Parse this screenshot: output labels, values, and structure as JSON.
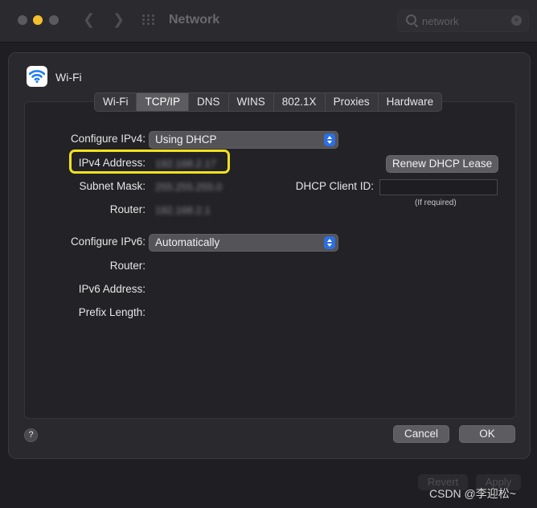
{
  "titlebar": {
    "title": "Network",
    "search_value": "network",
    "icons": [
      "close-dot",
      "minimize-dot",
      "maximize-dot",
      "back-arrow",
      "forward-arrow",
      "grid-icon",
      "search-icon",
      "clear-icon"
    ]
  },
  "sheet": {
    "interface_name": "Wi-Fi",
    "tabs": [
      {
        "label": "Wi-Fi",
        "active": false
      },
      {
        "label": "TCP/IP",
        "active": true
      },
      {
        "label": "DNS",
        "active": false
      },
      {
        "label": "WINS",
        "active": false
      },
      {
        "label": "802.1X",
        "active": false
      },
      {
        "label": "Proxies",
        "active": false
      },
      {
        "label": "Hardware",
        "active": false
      }
    ],
    "ipv4": {
      "configure_label": "Configure IPv4:",
      "configure_value": "Using DHCP",
      "address_label": "IPv4 Address:",
      "address_value": "192.168.2.17",
      "subnet_label": "Subnet Mask:",
      "subnet_value": "255.255.255.0",
      "router_label": "Router:",
      "router_value": "192.168.2.1"
    },
    "renew_button": "Renew DHCP Lease",
    "dhcp_client_label": "DHCP Client ID:",
    "dhcp_client_value": "",
    "dhcp_hint": "(If required)",
    "ipv6": {
      "configure_label": "Configure IPv6:",
      "configure_value": "Automatically",
      "router_label": "Router:",
      "address_label": "IPv6 Address:",
      "prefix_label": "Prefix Length:"
    },
    "help": "?",
    "cancel_button": "Cancel",
    "ok_button": "OK"
  },
  "footer": {
    "revert_button": "Revert",
    "apply_button": "Apply"
  },
  "watermark": "CSDN @李迎松~",
  "colors": {
    "highlight": "#f2e21e",
    "accent": "#2c6fe0",
    "minimize": "#f5c02d"
  }
}
